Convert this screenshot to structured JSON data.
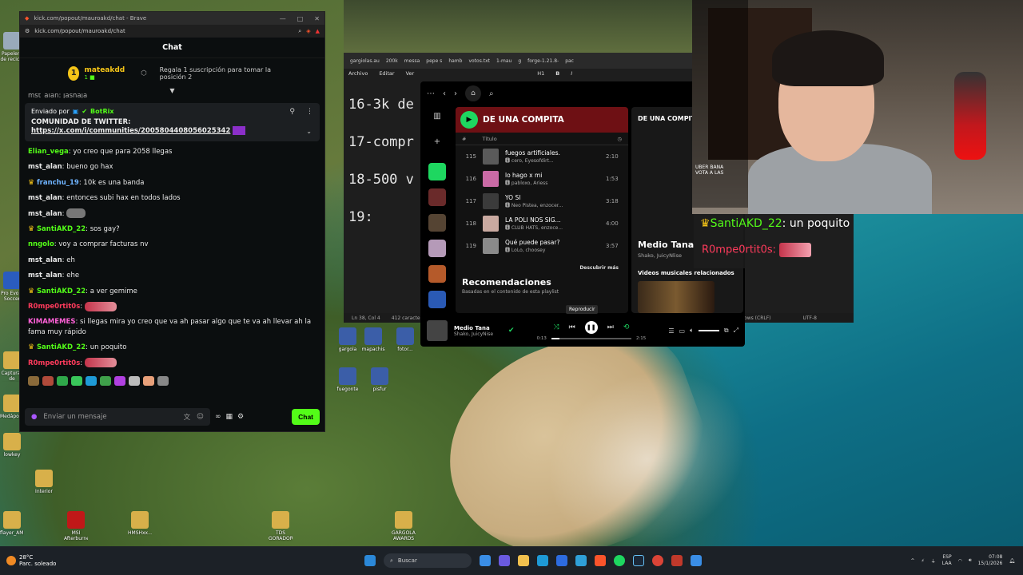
{
  "browser": {
    "tab_title": "kick.com/popout/mauroakd/chat - Brave",
    "url": "kick.com/popout/mauroakd/chat"
  },
  "chat": {
    "header": "Chat",
    "sub_rank": "1",
    "sub_user": "mateakdd",
    "sub_count": "1",
    "sub_cta": "Regala 1 suscripción para tomar la posición 2",
    "truncated_top": "mst_alan: jashaja",
    "pinned": {
      "sent_by": "Enviado por",
      "bot": "BotRix",
      "title": "COMUNIDAD DE TWITTER:",
      "link": "https://x.com/i/communities/2005804408056025342"
    },
    "messages": [
      {
        "user": "Elian_vega",
        "text": "yo creo que para 2058 llegas",
        "color": "#53fc18",
        "sub": false
      },
      {
        "user": "mst_alan",
        "text": "bueno go hax",
        "color": "#e8e8e8",
        "sub": false
      },
      {
        "user": "franchu_19",
        "text": "10k es una banda",
        "color": "#6fb4ff",
        "sub": true
      },
      {
        "user": "mst_alan",
        "text": "entonces subi hax en todos lados",
        "color": "#e8e8e8",
        "sub": false
      },
      {
        "user": "mst_alan",
        "text": "",
        "color": "#e8e8e8",
        "sub": false,
        "emote": "grey"
      },
      {
        "user": "SantiAKD_22",
        "text": "sos gay?",
        "color": "#53fc18",
        "sub": true
      },
      {
        "user": "nngolo",
        "text": "voy a comprar facturas nv",
        "color": "#53fc18",
        "sub": false
      },
      {
        "user": "mst_alan",
        "text": "eh",
        "color": "#e8e8e8",
        "sub": false
      },
      {
        "user": "mst_alan",
        "text": "ehe",
        "color": "#e8e8e8",
        "sub": false
      },
      {
        "user": "SantiAKD_22",
        "text": "a ver gemime",
        "color": "#53fc18",
        "sub": true
      },
      {
        "user": "R0mpe0rtit0s",
        "text": "",
        "color": "#ff3b5c",
        "sub": false,
        "emote": "red"
      },
      {
        "user": "KIMAMEMES",
        "text": "si llegas mira yo creo que va ah pasar algo que te va ah llevar ah la fama muy rápido",
        "color": "#ff61d8",
        "sub": false,
        "wrap": true
      },
      {
        "user": "SantiAKD_22",
        "text": "un poquito",
        "color": "#53fc18",
        "sub": true
      },
      {
        "user": "R0mpe0rtit0s",
        "text": "",
        "color": "#ff3b5c",
        "sub": false,
        "emote": "red"
      }
    ],
    "input_placeholder": "Enviar un mensaje",
    "send_label": "Chat"
  },
  "editor": {
    "tabs": [
      "gargiolas.au",
      "200k",
      "messa",
      "pepe s",
      "hamb",
      "votos.txt",
      "1-mau",
      "g",
      "forge-1.21.8-",
      "pac"
    ],
    "menu": [
      "Archivo",
      "Editar",
      "Ver"
    ],
    "heading_marker": "H1",
    "lines": [
      "16-3k de",
      "17-compr",
      "18-500 v",
      "19:"
    ],
    "status_pos": "Ln 38, Col 4",
    "status_chars": "412 caracteres",
    "status_eol": "Windows (CRLF)",
    "status_enc": "UTF-8"
  },
  "spotify": {
    "avatar": "M",
    "playlist": "DE UNA COMPITA",
    "col_number": "#",
    "col_title": "Título",
    "tracks": [
      {
        "num": "115",
        "title": "fuegos artificiales.",
        "artist": "cero, Eyesofdirt...",
        "dur": "2:10",
        "color": "#5a5a5a"
      },
      {
        "num": "116",
        "title": "lo hago x mi",
        "artist": "pabloxo, Ariess",
        "dur": "1:53",
        "color": "#c96aa5"
      },
      {
        "num": "117",
        "title": "YO SI",
        "artist": "Neo Pistea, enzocer...",
        "dur": "3:18",
        "color": "#3b3b3b"
      },
      {
        "num": "118",
        "title": "LA POLI NOS SIG...",
        "artist": "CLUB HATS, enzoce...",
        "dur": "4:00",
        "color": "#c9a9a0"
      },
      {
        "num": "119",
        "title": "Qué puede pasar?",
        "artist": "LoLo, choosey",
        "dur": "3:57",
        "color": "#8a8a8a"
      }
    ],
    "discover": "Descubrir más",
    "rec_title": "Recomendaciones",
    "rec_sub": "Basadas en el contenido de esta playlist",
    "right_title": "DE UNA COMPITA",
    "np_song": "Medio Tana",
    "np_artist": "Shako, JuicyNlise",
    "videos": "Videos musicales relacionados",
    "tooltip": "Reproducir",
    "player": {
      "song": "Medio Tana",
      "artist": "Shako, JuicyNise",
      "time_current": "0:13",
      "time_total": "2:15",
      "progress": 0.1
    }
  },
  "webcam": {
    "overlay_text1": "UBER BANA",
    "overlay_text2": "VOTA A LAS"
  },
  "overlay_chat": {
    "line1_user": "SantiAKD_22",
    "line1_text": "un poquito",
    "line2_user": "R0mpe0rtit0s:"
  },
  "taskbar": {
    "temp": "28°C",
    "weather": "Parc. soleado",
    "search": "Buscar",
    "lang1": "ESP",
    "lang2": "LAA",
    "time": "07:08",
    "date": "15/1/2026"
  },
  "desktop_icons": [
    {
      "label": "Papelera de recicla",
      "color": "#9ab"
    },
    {
      "label": "Pro Evolu Soccer",
      "color": "#2a5cbe"
    },
    {
      "label": "Capturas de pantalla",
      "color": "#d8b04a"
    },
    {
      "label": "Medápolis",
      "color": "#d8b04a"
    },
    {
      "label": "lowkey",
      "color": "#d8b04a"
    },
    {
      "label": "Interior",
      "color": "#d8b04a"
    },
    {
      "label": "flayer_AME",
      "color": "#d8b04a"
    },
    {
      "label": "MSI Afterburner",
      "color": "#c01818"
    },
    {
      "label": "HMSHxx...",
      "color": "#d8b04a"
    },
    {
      "label": "TDS GORADOR",
      "color": "#d8b04a"
    },
    {
      "label": "GARGOLAS AWARDS",
      "color": "#d8b04a"
    },
    {
      "label": "fuegonte",
      "color": "#3b5ea8"
    },
    {
      "label": "pisfur",
      "color": "#3b5ea8"
    },
    {
      "label": "gargola",
      "color": "#3b5ea8"
    },
    {
      "label": "mapachis",
      "color": "#3b5ea8"
    },
    {
      "label": "fotor...",
      "color": "#3b5ea8"
    }
  ]
}
